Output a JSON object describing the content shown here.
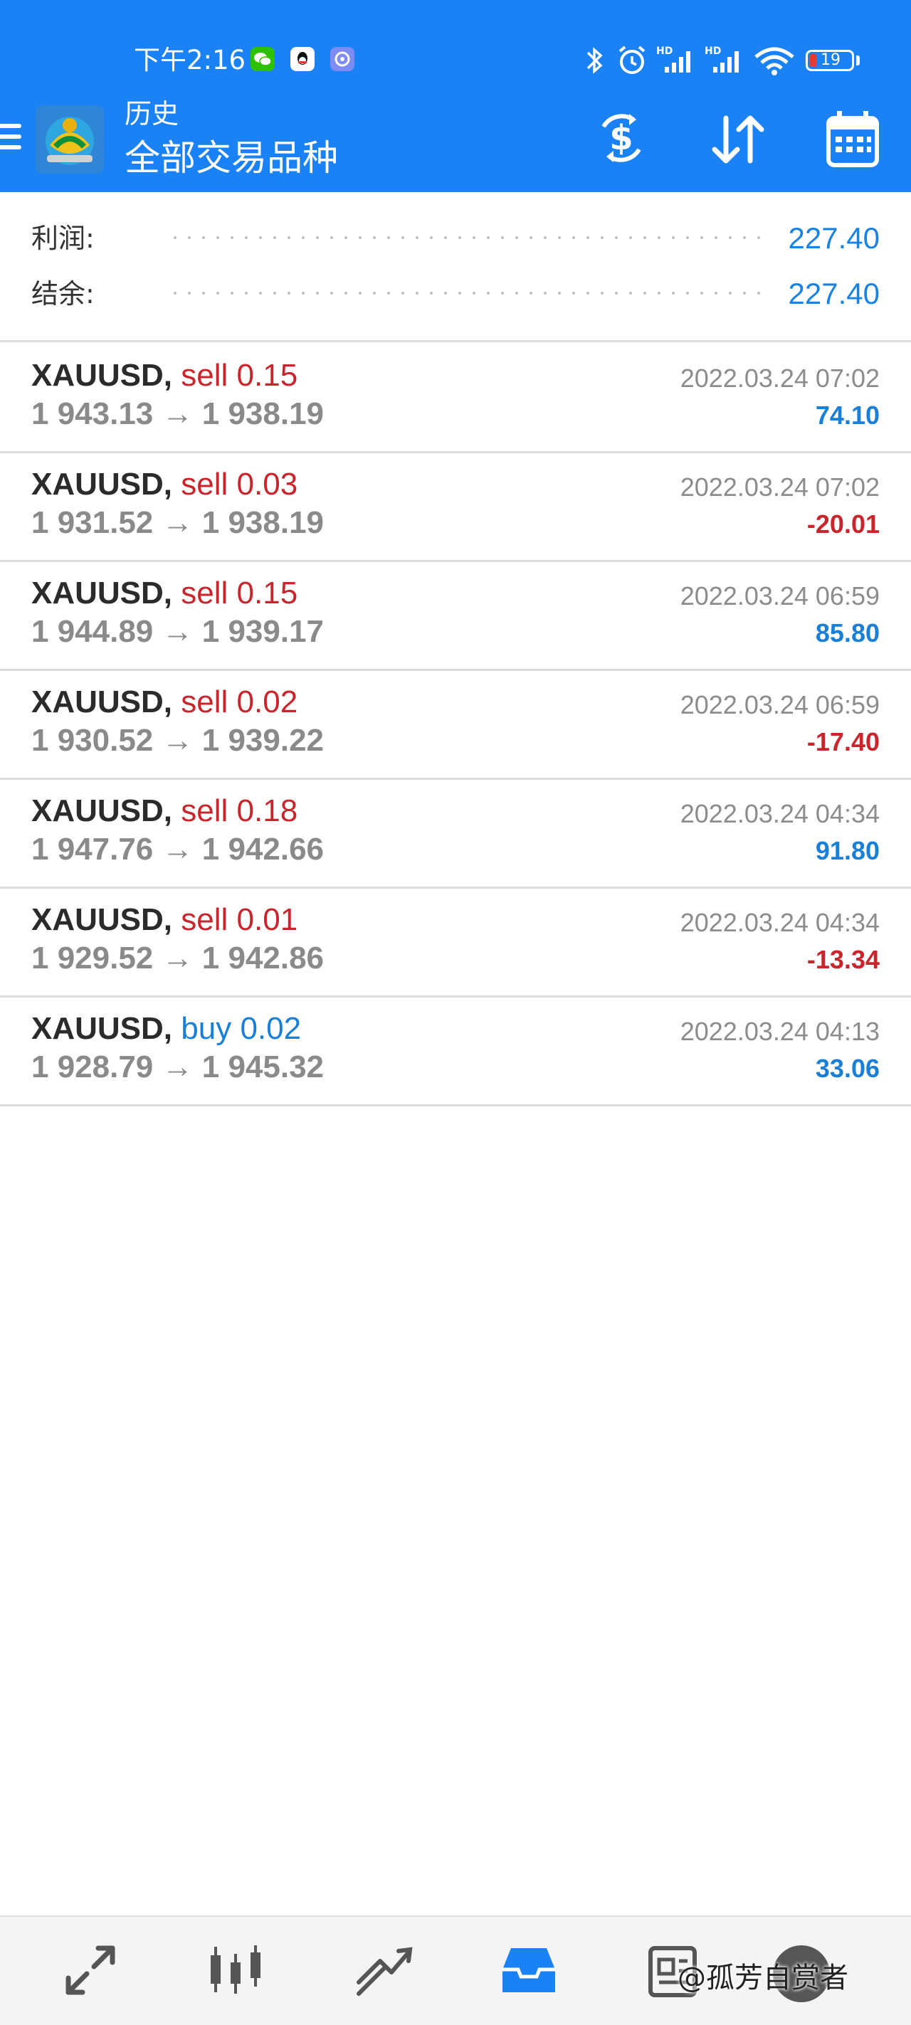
{
  "status_bar": {
    "time": "下午2:16",
    "battery": "19",
    "icons": [
      "wechat-icon",
      "qq-icon",
      "app-notification-icon",
      "bluetooth-icon",
      "alarm-icon",
      "signal-hd-icon",
      "signal-hd-icon",
      "wifi-icon",
      "battery-icon"
    ]
  },
  "header": {
    "subtitle": "历史",
    "title": "全部交易品种",
    "actions": [
      "currency-exchange-icon",
      "sort-icon",
      "calendar-icon"
    ]
  },
  "summary": {
    "profit_label": "利润:",
    "profit_value": "227.40",
    "balance_label": "结余:",
    "balance_value": "227.40"
  },
  "trades": [
    {
      "symbol": "XAUUSD,",
      "side": "sell",
      "volume": "0.15",
      "open": "1 943.13",
      "close": "1 938.19",
      "time": "2022.03.24 07:02",
      "profit": "74.10",
      "profit_sign": "positive"
    },
    {
      "symbol": "XAUUSD,",
      "side": "sell",
      "volume": "0.03",
      "open": "1 931.52",
      "close": "1 938.19",
      "time": "2022.03.24 07:02",
      "profit": "-20.01",
      "profit_sign": "negative"
    },
    {
      "symbol": "XAUUSD,",
      "side": "sell",
      "volume": "0.15",
      "open": "1 944.89",
      "close": "1 939.17",
      "time": "2022.03.24 06:59",
      "profit": "85.80",
      "profit_sign": "positive"
    },
    {
      "symbol": "XAUUSD,",
      "side": "sell",
      "volume": "0.02",
      "open": "1 930.52",
      "close": "1 939.22",
      "time": "2022.03.24 06:59",
      "profit": "-17.40",
      "profit_sign": "negative"
    },
    {
      "symbol": "XAUUSD,",
      "side": "sell",
      "volume": "0.18",
      "open": "1 947.76",
      "close": "1 942.66",
      "time": "2022.03.24 04:34",
      "profit": "91.80",
      "profit_sign": "positive"
    },
    {
      "symbol": "XAUUSD,",
      "side": "sell",
      "volume": "0.01",
      "open": "1 929.52",
      "close": "1 942.86",
      "time": "2022.03.24 04:34",
      "profit": "-13.34",
      "profit_sign": "negative"
    },
    {
      "symbol": "XAUUSD,",
      "side": "buy",
      "volume": "0.02",
      "open": "1 928.79",
      "close": "1 945.32",
      "time": "2022.03.24 04:13",
      "profit": "33.06",
      "profit_sign": "positive"
    }
  ],
  "arrow_glyph": "→",
  "bottom_nav": {
    "items": [
      "quotes-icon",
      "chart-icon",
      "trade-icon",
      "history-icon",
      "messages-icon"
    ],
    "active": "history-icon"
  },
  "watermark": "@孤芳自赏者",
  "colors": {
    "header_blue": "#1a82f5",
    "value_blue": "#1a82e0",
    "sell_red": "#c8262c",
    "buy_blue": "#1a7fd6"
  }
}
